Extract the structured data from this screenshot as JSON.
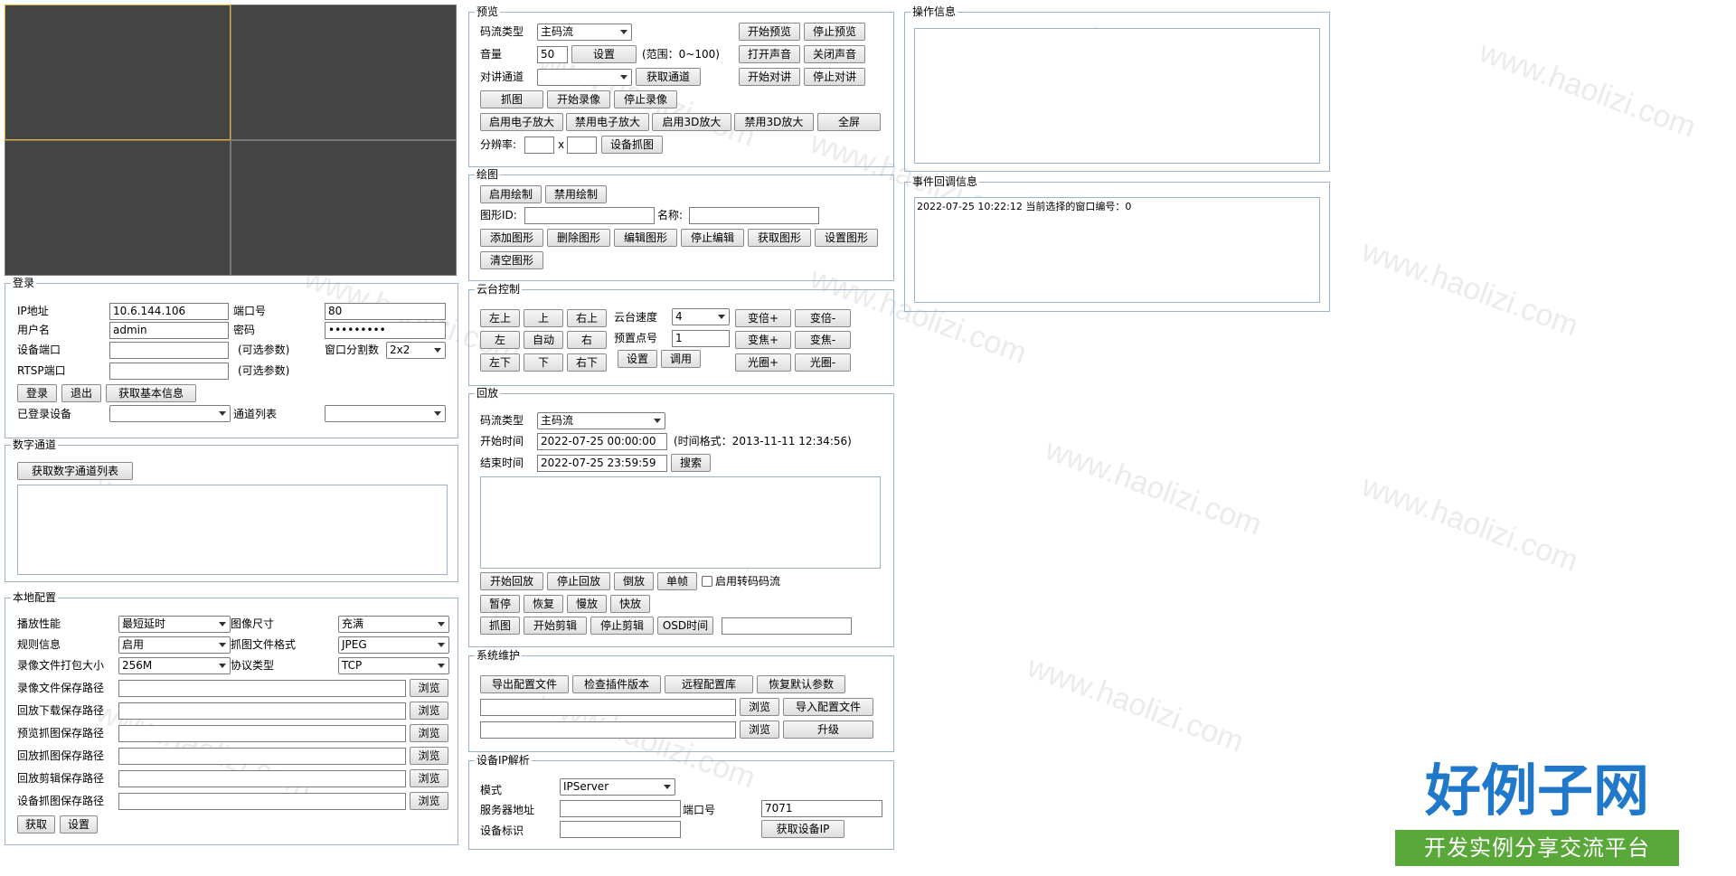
{
  "watermark": "www.haolizi.com",
  "login": {
    "legend": "登录",
    "ip_label": "IP地址",
    "ip_value": "10.6.144.106",
    "port_label": "端口号",
    "port_value": "80",
    "user_label": "用户名",
    "user_value": "admin",
    "pwd_label": "密码",
    "pwd_value": "•••••••••",
    "devport_label": "设备端口",
    "optional": "(可选参数)",
    "winsplit_label": "窗口分割数",
    "winsplit_value": "2x2",
    "rtsp_label": "RTSP端口",
    "login_btn": "登录",
    "logout_btn": "退出",
    "info_btn": "获取基本信息",
    "logged_label": "已登录设备",
    "channel_label": "通道列表"
  },
  "digital": {
    "legend": "数字通道",
    "get_btn": "获取数字通道列表"
  },
  "local": {
    "legend": "本地配置",
    "perf_label": "播放性能",
    "perf_value": "最短延时",
    "imgsize_label": "图像尺寸",
    "imgsize_value": "充满",
    "rule_label": "规则信息",
    "rule_value": "启用",
    "capfmt_label": "抓图文件格式",
    "capfmt_value": "JPEG",
    "pack_label": "录像文件打包大小",
    "pack_value": "256M",
    "proto_label": "协议类型",
    "proto_value": "TCP",
    "paths": [
      "录像文件保存路径",
      "回放下载保存路径",
      "预览抓图保存路径",
      "回放抓图保存路径",
      "回放剪辑保存路径",
      "设备抓图保存路径"
    ],
    "browse": "浏览",
    "get_btn": "获取",
    "set_btn": "设置"
  },
  "preview": {
    "legend": "预览",
    "stream_label": "码流类型",
    "stream_value": "主码流",
    "start_btn": "开始预览",
    "stop_btn": "停止预览",
    "vol_label": "音量",
    "vol_value": "50",
    "vol_set": "设置",
    "vol_range": "(范围：0~100)",
    "open_sound": "打开声音",
    "close_sound": "关闭声音",
    "talk_label": "对讲通道",
    "get_channel": "获取通道",
    "start_talk": "开始对讲",
    "stop_talk": "停止对讲",
    "capture": "抓图",
    "start_rec": "开始录像",
    "stop_rec": "停止录像",
    "ezoom_on": "启用电子放大",
    "ezoom_off": "禁用电子放大",
    "zoom3d_on": "启用3D放大",
    "zoom3d_off": "禁用3D放大",
    "fullscreen": "全屏",
    "res_label": "分辨率:",
    "res_x": "x",
    "dev_capture": "设备抓图"
  },
  "draw": {
    "legend": "绘图",
    "enable": "启用绘制",
    "disable": "禁用绘制",
    "shape_id": "图形ID:",
    "name": "名称:",
    "add": "添加图形",
    "del": "删除图形",
    "edit": "编辑图形",
    "stop_edit": "停止编辑",
    "get": "获取图形",
    "set": "设置图形",
    "clear": "清空图形"
  },
  "ptz": {
    "legend": "云台控制",
    "ul": "左上",
    "up": "上",
    "ur": "右上",
    "left": "左",
    "auto": "自动",
    "right": "右",
    "dl": "左下",
    "down": "下",
    "dr": "右下",
    "speed_label": "云台速度",
    "speed_value": "4",
    "preset_label": "预置点号",
    "preset_value": "1",
    "set": "设置",
    "call": "调用",
    "zoom_in": "变倍+",
    "zoom_out": "变倍-",
    "focus_in": "变焦+",
    "focus_out": "变焦-",
    "iris_in": "光圈+",
    "iris_out": "光圈-"
  },
  "playback": {
    "legend": "回放",
    "stream_label": "码流类型",
    "stream_value": "主码流",
    "start_label": "开始时间",
    "start_value": "2022-07-25 00:00:00",
    "time_fmt": "(时间格式：2013-11-11 12:34:56)",
    "end_label": "结束时间",
    "end_value": "2022-07-25 23:59:59",
    "search": "搜索",
    "start_btn": "开始回放",
    "stop_btn": "停止回放",
    "reverse": "倒放",
    "frame": "单帧",
    "transcode": "启用转码码流",
    "pause": "暂停",
    "resume": "恢复",
    "slow": "慢放",
    "fast": "快放",
    "capture": "抓图",
    "start_clip": "开始剪辑",
    "stop_clip": "停止剪辑",
    "osd": "OSD时间"
  },
  "maint": {
    "legend": "系统维护",
    "export": "导出配置文件",
    "check": "检查插件版本",
    "remote": "远程配置库",
    "restore": "恢复默认参数",
    "browse": "浏览",
    "import": "导入配置文件",
    "upgrade": "升级"
  },
  "ipparse": {
    "legend": "设备IP解析",
    "mode_label": "模式",
    "mode_value": "IPServer",
    "server_label": "服务器地址",
    "port_label": "端口号",
    "port_value": "7071",
    "devid_label": "设备标识",
    "get_ip": "获取设备IP"
  },
  "opinfo": {
    "legend": "操作信息"
  },
  "event": {
    "legend": "事件回调信息",
    "message": "2022-07-25 10:22:12 当前选择的窗口编号：0"
  },
  "logo": {
    "main": "好例子网",
    "sub": "开发实例分享交流平台"
  },
  "colors": {
    "selected_pane": "#e6b422",
    "fieldset_border": "#9ab3cc",
    "logo_blue": "#1f78c9",
    "logo_green": "#5aa73a"
  }
}
